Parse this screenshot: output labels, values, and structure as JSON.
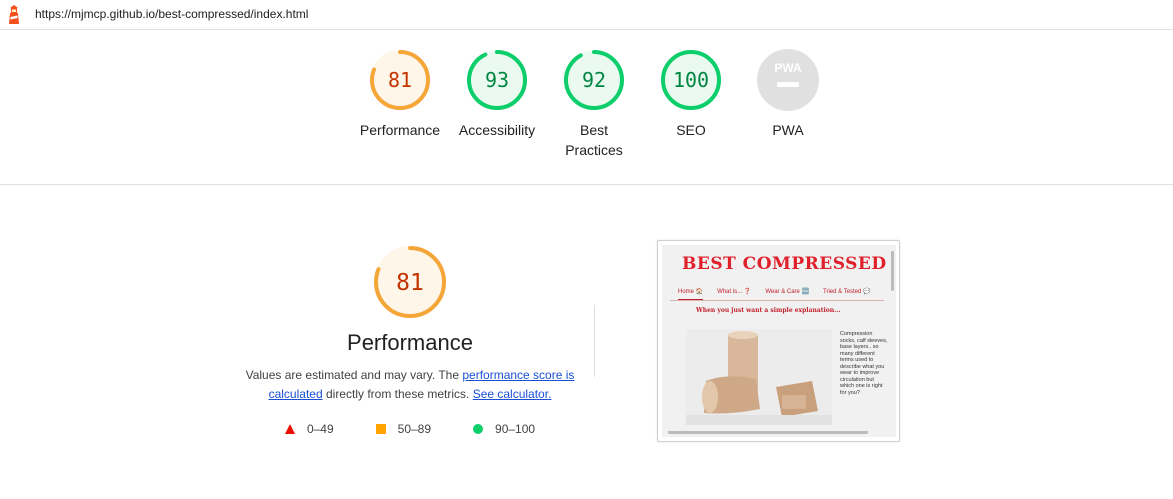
{
  "address_bar": {
    "url": "https://mjmcp.github.io/best-compressed/index.html"
  },
  "gauges": [
    {
      "label": "Performance",
      "score": "81",
      "value": 0.81,
      "color": "#f4a638",
      "fill": "#fff6ea",
      "text_color": "#c33300"
    },
    {
      "label": "Accessibility",
      "score": "93",
      "value": 0.93,
      "color": "#0cce6b",
      "fill": "#eafaf0",
      "text_color": "#018642"
    },
    {
      "label": "Best Practices",
      "score": "92",
      "value": 0.92,
      "color": "#0cce6b",
      "fill": "#eafaf0",
      "text_color": "#018642"
    },
    {
      "label": "SEO",
      "score": "100",
      "value": 1.0,
      "color": "#0cce6b",
      "fill": "#eafaf0",
      "text_color": "#018642"
    },
    {
      "label": "PWA",
      "score": "PWA",
      "value": 0,
      "color": "#e0e0e0",
      "fill": "#e0e0e0",
      "text_color": "#ffffff"
    }
  ],
  "performance": {
    "score": "81",
    "value": 0.81,
    "title": "Performance",
    "desc_prefix": "Values are estimated and may vary. The ",
    "link_score": "performance score is calculated",
    "desc_middle": " directly from these metrics. ",
    "link_calc": "See calculator.",
    "legend": [
      {
        "range": "0–49",
        "shape": "triangle",
        "color": "#eb0f00"
      },
      {
        "range": "50–89",
        "shape": "square",
        "color": "#ffa400"
      },
      {
        "range": "90–100",
        "shape": "circle",
        "color": "#0cce6b"
      }
    ]
  },
  "screenshot": {
    "brand": "BEST COMPRESSED",
    "nav": [
      "Home 🏠",
      "What is... ❓",
      "Wear & Care 🆒",
      "Tried & Tested 💬"
    ],
    "tagline": "When you just want a simple explanation...",
    "side_text": "Compression socks, calf sleeves, base layers.. so many different terms used to describe what you wear to improve circulation but which one is right for you?"
  }
}
